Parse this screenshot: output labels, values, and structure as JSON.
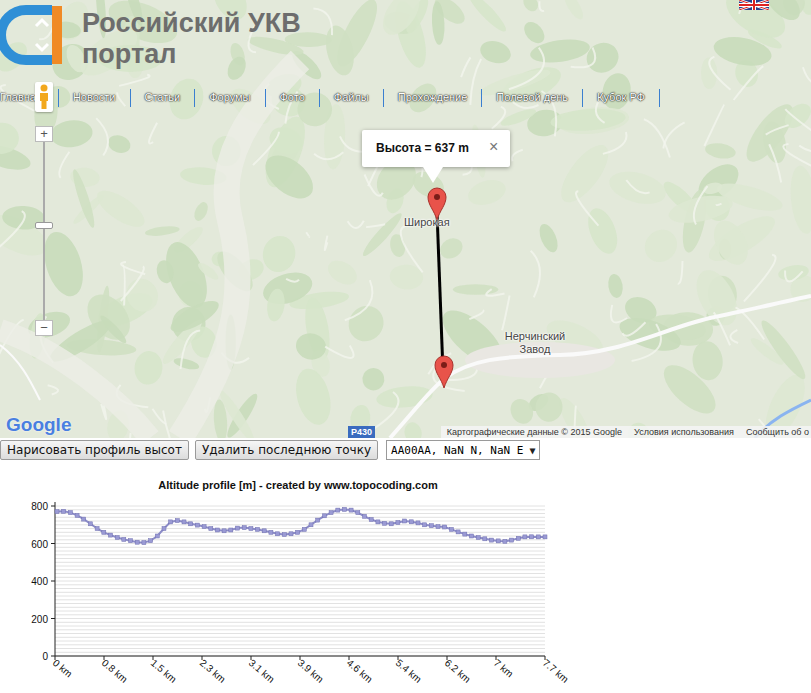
{
  "header": {
    "title_line1": "Российский УКВ",
    "title_line2": "портал"
  },
  "nav": [
    "Главна",
    "Новости",
    "Статьи",
    "Форумы",
    "Фото",
    "Файлы",
    "Прохождение",
    "Полевой день",
    "Кубок РФ"
  ],
  "map": {
    "zoom": {
      "plus": "+",
      "minus": "−",
      "level": 0.53
    },
    "popup": {
      "text": "Высота = 637 m",
      "close": "×"
    },
    "places": [
      "Широкая",
      "Нерчинский Завод"
    ],
    "road": "Р430",
    "logo": "Google",
    "footer": [
      "Картографические данные © 2015 Google",
      "Условия использования",
      "Сообщить об о"
    ]
  },
  "controls": {
    "buttons": [
      "Нарисовать профиль высот",
      "Удалить последнюю точку"
    ],
    "select": {
      "value": "AA00AA, NaN N, NaN E",
      "arrow": "▼"
    }
  },
  "chart": {
    "title": "Altitude profile [m] - created by www.topocoding.com",
    "y_ticks": [
      "0",
      "200",
      "400",
      "600",
      "800"
    ],
    "x_ticks": [
      "0 km",
      "0.8 km",
      "1.5 km",
      "2.3 km",
      "3.1 km",
      "3.9 km",
      "4.6 km",
      "5.4 km",
      "6.2 km",
      "7 km",
      "7.7 km"
    ],
    "series": [
      {
        "name": "altitude",
        "values": [
          770,
          772,
          765,
          750,
          730,
          705,
          680,
          660,
          645,
          632,
          622,
          615,
          607,
          605,
          615,
          640,
          680,
          715,
          722,
          715,
          705,
          698,
          690,
          680,
          672,
          668,
          672,
          682,
          685,
          680,
          675,
          668,
          660,
          652,
          648,
          652,
          660,
          675,
          700,
          725,
          748,
          765,
          778,
          782,
          778,
          765,
          745,
          728,
          715,
          708,
          705,
          712,
          720,
          716,
          710,
          700,
          695,
          690,
          688,
          675,
          662,
          650,
          640,
          632,
          625,
          618,
          614,
          612,
          618,
          628,
          635,
          636,
          635,
          635
        ]
      }
    ]
  }
}
